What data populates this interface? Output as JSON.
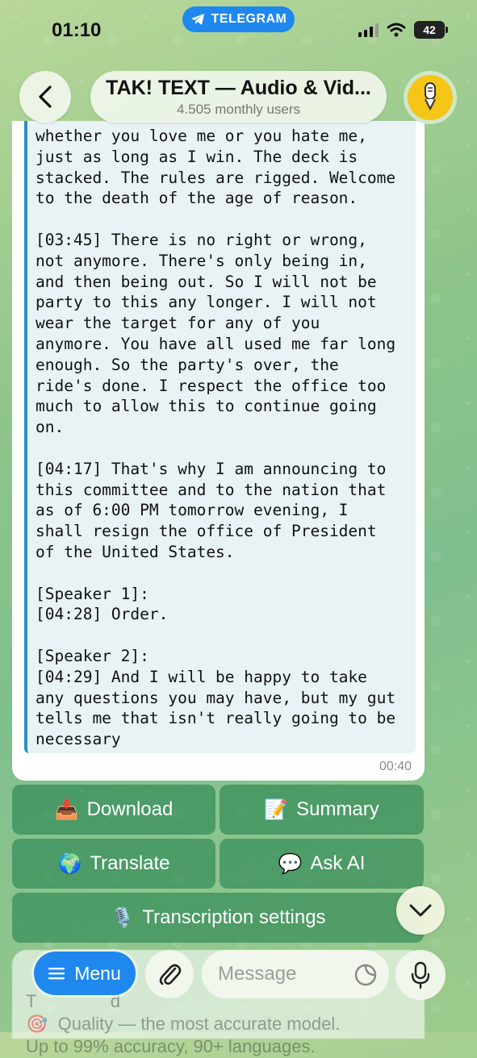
{
  "status_bar": {
    "time": "01:10",
    "app_pill": "TELEGRAM",
    "battery": "42"
  },
  "header": {
    "title": "TAK! TEXT — Audio & Vid...",
    "subtitle": "4.505 monthly users"
  },
  "message": {
    "transcript": "whether you love me or you hate me,\njust as long as I win. The deck is\nstacked. The rules are rigged. Welcome\nto the death of the age of reason.\n\n[03:45] There is no right or wrong,\nnot anymore. There's only being in,\nand then being out. So I will not be\nparty to this any longer. I will not\nwear the target for any of you\nanymore. You have all used me far long\nenough. So the party's over, the\nride's done. I respect the office too\nmuch to allow this to continue going\non.\n\n[04:17] That's why I am announcing to\nthis committee and to the nation that\nas of 6:00 PM tomorrow evening, I\nshall resign the office of President\nof the United States.\n\n[Speaker 1]:\n[04:28] Order.\n\n[Speaker 2]:\n[04:29] And I will be happy to take\nany questions you may have, but my gut\ntells me that isn't really going to be\nnecessary",
    "time": "00:40"
  },
  "keyboard": {
    "download": {
      "emoji": "📥",
      "label": "Download"
    },
    "summary": {
      "emoji": "📝",
      "label": "Summary"
    },
    "translate": {
      "emoji": "🌍",
      "label": "Translate"
    },
    "ask_ai": {
      "emoji": "💬",
      "label": "Ask AI"
    },
    "transcription_settings": {
      "emoji": "🎙️",
      "label": "Transcription settings"
    }
  },
  "composer": {
    "menu_label": "Menu",
    "placeholder": "Message",
    "underlay_text": "T               d\n🎯  Quality — the most accurate model.\nUp to 99% accuracy, 90+ languages."
  },
  "colors": {
    "accent_blue": "#1e88ef",
    "keyboard_green": "#268250",
    "quote_bar": "#2b8fc6"
  }
}
